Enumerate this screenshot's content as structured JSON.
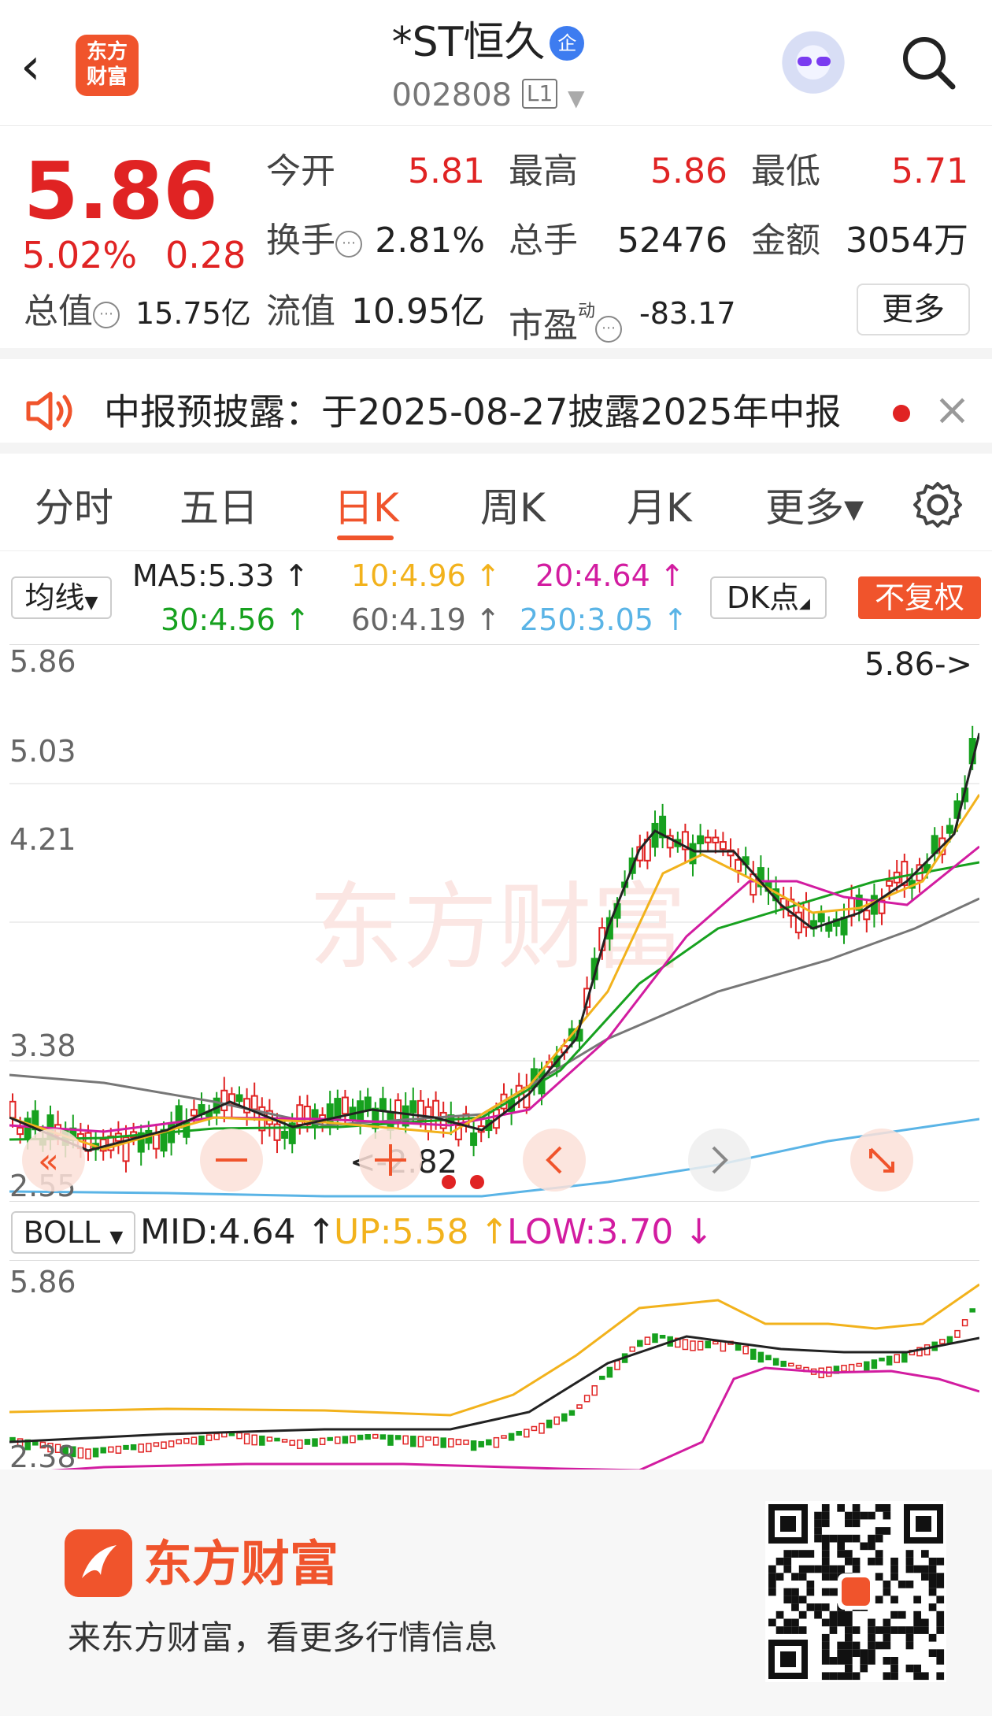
{
  "header": {
    "back_icon": "back-arrow-icon",
    "logo_text": "东方财富",
    "title": "*ST恒久",
    "title_badge": "企",
    "code": "002808",
    "code_badge": "L1"
  },
  "quote": {
    "price": "5.86",
    "change_pct": "5.02%",
    "change": "0.28",
    "open_label": "今开",
    "open": "5.81",
    "high_label": "最高",
    "high": "5.86",
    "low_label": "最低",
    "low": "5.71",
    "turnover_label": "换手",
    "turnover": "2.81%",
    "volume_label": "总手",
    "volume": "52476",
    "amount_label": "金额",
    "amount": "3054万",
    "mktcap_label": "总值",
    "mktcap": "15.75亿",
    "float_label": "流值",
    "float": "10.95亿",
    "pe_label": "市盈",
    "pe_sup": "动",
    "pe": "-83.17",
    "more": "更多",
    "up_color": "#e02323"
  },
  "notice": {
    "text": "中报预披露：于2025-08-27披露2025年中报",
    "icon": "speaker-icon"
  },
  "tabs": [
    {
      "label": "分时"
    },
    {
      "label": "五日"
    },
    {
      "label": "日K"
    },
    {
      "label": "周K"
    },
    {
      "label": "月K"
    },
    {
      "label": "更多▾"
    }
  ],
  "active_tab": "日K",
  "ma": {
    "selector": "均线",
    "ma5": "MA5:5.33 ↑",
    "ma10": "10:4.96 ↑",
    "ma20": "20:4.64 ↑",
    "ma30": "30:4.56 ↑",
    "ma60": "60:4.19 ↑",
    "ma250": "250:3.05 ↑",
    "dk": "DK点",
    "fq": "不复权",
    "colors": {
      "ma5": "#222222",
      "ma10": "#f2b21c",
      "ma20": "#d21ca0",
      "ma30": "#17a11f",
      "ma60": "#777777",
      "ma250": "#5ab4e6"
    }
  },
  "main_chart": {
    "y_labels": [
      "5.86",
      "5.03",
      "4.21",
      "3.38",
      "2.55"
    ],
    "max_label": "5.86->",
    "min_label": "<-2.82"
  },
  "boll": {
    "selector": "BOLL",
    "mid": "MID:4.64 ↑",
    "up": "UP:5.58 ↑",
    "low": "LOW:3.70 ↓",
    "y_labels": [
      "5.86",
      "2.38"
    ]
  },
  "footer": {
    "brand": "东方财富",
    "slogan": "来东方财富，看更多行情信息"
  }
}
